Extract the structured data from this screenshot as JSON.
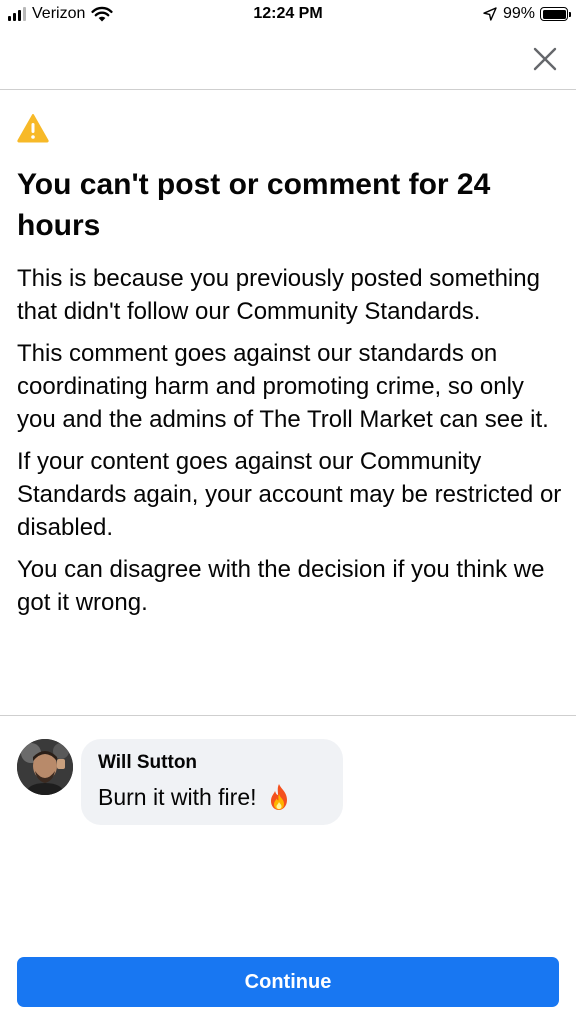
{
  "status_bar": {
    "carrier": "Verizon",
    "time": "12:24 PM",
    "battery_percent": "99%",
    "icons": [
      "signal-bars-icon",
      "wifi-icon",
      "location-arrow-icon",
      "battery-icon"
    ]
  },
  "header": {
    "close_icon": "close-icon"
  },
  "notice": {
    "icon": "warning-icon",
    "title": "You can't post or comment for 24 hours",
    "paragraphs": [
      "This is because you previously posted something that didn't follow our Community Standards.",
      "This comment goes against our standards on coordinating harm and promoting crime, so only you and the admins of The Troll Market can see it.",
      "If your content goes against our Community Standards again, your account may be restricted or disabled.",
      "You can disagree with the decision if you think we got it wrong."
    ]
  },
  "comment": {
    "author": "Will Sutton",
    "text": "Burn it with fire!",
    "emoji_icon": "fire-emoji-icon"
  },
  "actions": {
    "continue_label": "Continue"
  },
  "colors": {
    "primary": "#1877f2",
    "warning": "#f7b928",
    "bubble": "#f0f2f5",
    "divider": "#cfcfcf"
  }
}
